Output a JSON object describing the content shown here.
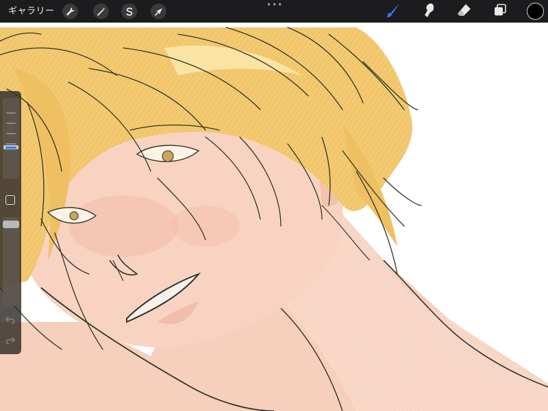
{
  "toolbar": {
    "gallery_label": "ギャラリー",
    "actions_icon": "wrench-icon",
    "adjustments_icon": "magic-wand-icon",
    "selection_icon": "selection-s-icon",
    "transform_icon": "arrow-cursor-icon",
    "more_label": "•••",
    "brush_icon": "paintbrush-icon",
    "smudge_icon": "smudge-fingertip-icon",
    "eraser_icon": "eraser-icon",
    "layers_icon": "layers-icon",
    "color_icon": "color-swatch",
    "active_tool": "brush",
    "active_color": "#000000",
    "accent_color": "#2f7bf6"
  },
  "sidebar": {
    "brush_size": 0.38,
    "brush_opacity": 0.96,
    "modify_icon": "square-modify-icon",
    "undo_icon": "undo-arrow-icon",
    "redo_icon": "redo-arrow-icon"
  },
  "canvas": {
    "description_colors": {
      "paper": "#ffffff",
      "skin": "#f8d5c3",
      "hair": "#f2c666",
      "lineart": "#2c3326"
    }
  }
}
